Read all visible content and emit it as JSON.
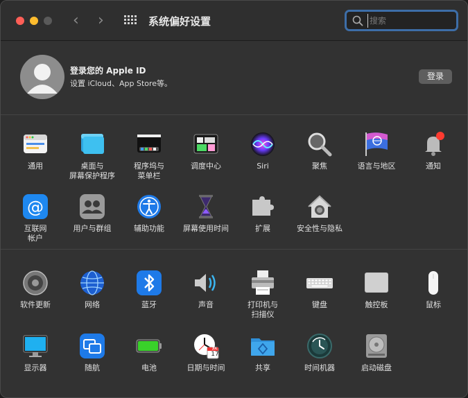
{
  "window": {
    "title": "系统偏好设置"
  },
  "search": {
    "placeholder": "搜索"
  },
  "account": {
    "title": "登录您的 Apple ID",
    "subtitle": "设置 iCloud、App Store等。",
    "login_label": "登录"
  },
  "panes_row1": [
    {
      "label": "通用",
      "icon": "general-icon"
    },
    {
      "label": "桌面与\n屏幕保护程序",
      "icon": "desktop-icon"
    },
    {
      "label": "程序坞与\n菜单栏",
      "icon": "dock-icon"
    },
    {
      "label": "调度中心",
      "icon": "mission-control-icon"
    },
    {
      "label": "Siri",
      "icon": "siri-icon"
    },
    {
      "label": "聚焦",
      "icon": "spotlight-icon"
    },
    {
      "label": "语言与地区",
      "icon": "language-region-icon"
    },
    {
      "label": "通知",
      "icon": "notifications-icon"
    }
  ],
  "panes_row2": [
    {
      "label": "互联网\n帐户",
      "icon": "internet-accounts-icon"
    },
    {
      "label": "用户与群组",
      "icon": "users-groups-icon"
    },
    {
      "label": "辅助功能",
      "icon": "accessibility-icon"
    },
    {
      "label": "屏幕使用时间",
      "icon": "screen-time-icon"
    },
    {
      "label": "扩展",
      "icon": "extensions-icon"
    },
    {
      "label": "安全性与隐私",
      "icon": "security-privacy-icon"
    }
  ],
  "panes_row3": [
    {
      "label": "软件更新",
      "icon": "software-update-icon"
    },
    {
      "label": "网络",
      "icon": "network-icon"
    },
    {
      "label": "蓝牙",
      "icon": "bluetooth-icon"
    },
    {
      "label": "声音",
      "icon": "sound-icon"
    },
    {
      "label": "打印机与\n扫描仪",
      "icon": "printer-icon"
    },
    {
      "label": "键盘",
      "icon": "keyboard-icon"
    },
    {
      "label": "触控板",
      "icon": "trackpad-icon"
    },
    {
      "label": "鼠标",
      "icon": "mouse-icon"
    }
  ],
  "panes_row4": [
    {
      "label": "显示器",
      "icon": "displays-icon"
    },
    {
      "label": "随航",
      "icon": "sidecar-icon"
    },
    {
      "label": "电池",
      "icon": "battery-icon"
    },
    {
      "label": "日期与时间",
      "icon": "date-time-icon"
    },
    {
      "label": "共享",
      "icon": "sharing-icon"
    },
    {
      "label": "时间机器",
      "icon": "time-machine-icon"
    },
    {
      "label": "启动磁盘",
      "icon": "startup-disk-icon"
    }
  ],
  "date_time_icon_text": {
    "month": "JUL",
    "day": "17"
  }
}
